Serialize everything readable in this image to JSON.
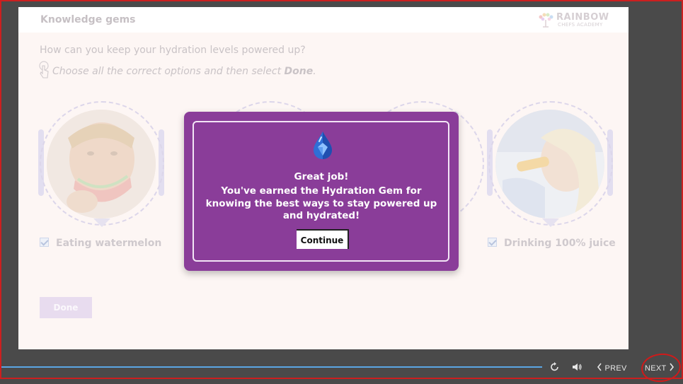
{
  "slide": {
    "title": "Knowledge gems",
    "logo": {
      "name": "RAINBOW",
      "sub": "CHEFS ACADEMY"
    },
    "question": "How can you keep your hydration levels powered up?",
    "instruction_prefix": "Choose all the correct options and then select ",
    "instruction_bold": "Done",
    "instruction_suffix": ".",
    "options": [
      {
        "label": "Eating watermelon",
        "checked": true
      },
      {
        "label": "Drinking 100% juice",
        "checked": true
      }
    ],
    "done_label": "Done"
  },
  "modal": {
    "icon": "water-drop-gem-icon",
    "heading": "Great job!",
    "body": "You've earned the Hydration Gem for knowing the best ways to stay powered up and hydrated!",
    "continue_label": "Continue"
  },
  "player": {
    "prev_label": "PREV",
    "next_label": "NEXT",
    "icons": [
      "replay-icon",
      "volume-icon",
      "chevron-left-icon",
      "chevron-right-icon"
    ]
  },
  "colors": {
    "modal_bg": "#8a3d99",
    "progress": "#5aa6e4",
    "annotation": "#d01a1a"
  }
}
